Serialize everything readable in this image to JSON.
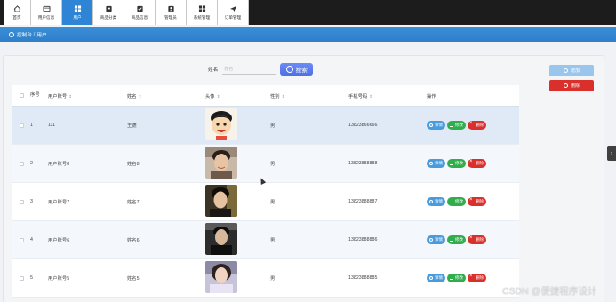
{
  "nav": {
    "items": [
      {
        "label": "首页",
        "icon": "home-icon",
        "active": false
      },
      {
        "label": "用户信息",
        "icon": "id-card-icon",
        "active": false
      },
      {
        "label": "用户",
        "icon": "grid-icon",
        "active": true
      },
      {
        "label": "商品分类",
        "icon": "box-icon",
        "active": false
      },
      {
        "label": "商品信息",
        "icon": "checkbox-icon",
        "active": false
      },
      {
        "label": "管理员",
        "icon": "user-icon",
        "active": false
      },
      {
        "label": "系统管理",
        "icon": "grid-icon",
        "active": false
      },
      {
        "label": "订单管理",
        "icon": "send-icon",
        "active": false
      }
    ]
  },
  "breadcrumb": {
    "home": "控制台",
    "separator": "/",
    "current": "用户"
  },
  "search": {
    "label": "姓名",
    "placeholder": "姓名",
    "button": "搜索"
  },
  "actions": {
    "add": "增加",
    "delete": "删除"
  },
  "table": {
    "headers": {
      "index": "序号",
      "account": "用户账号",
      "name": "姓名",
      "avatar": "头像",
      "gender": "性别",
      "phone": "手机号码",
      "ops": "操作"
    },
    "op_labels": {
      "view": "详情",
      "edit": "修改",
      "remove": "删除"
    },
    "rows": [
      {
        "index": "1",
        "account": "111",
        "name": "王德",
        "gender": "男",
        "phone": "13823866666"
      },
      {
        "index": "2",
        "account": "用户账号8",
        "name": "姓名8",
        "gender": "男",
        "phone": "13823888888"
      },
      {
        "index": "3",
        "account": "用户账号7",
        "name": "姓名7",
        "gender": "男",
        "phone": "13823888887"
      },
      {
        "index": "4",
        "account": "用户账号6",
        "name": "姓名6",
        "gender": "男",
        "phone": "13823888886"
      },
      {
        "index": "5",
        "account": "用户账号5",
        "name": "姓名5",
        "gender": "男",
        "phone": "13823888885"
      }
    ]
  },
  "side_tab": "›",
  "watermark": "CSDN @便捷程序设计",
  "colors": {
    "nav_active": "#2e85d6",
    "breadcrumb": "#2f7fc9",
    "search": "#4f6fe6",
    "view": "#4a9bdc",
    "edit": "#2fae4b",
    "remove": "#d9302c"
  }
}
